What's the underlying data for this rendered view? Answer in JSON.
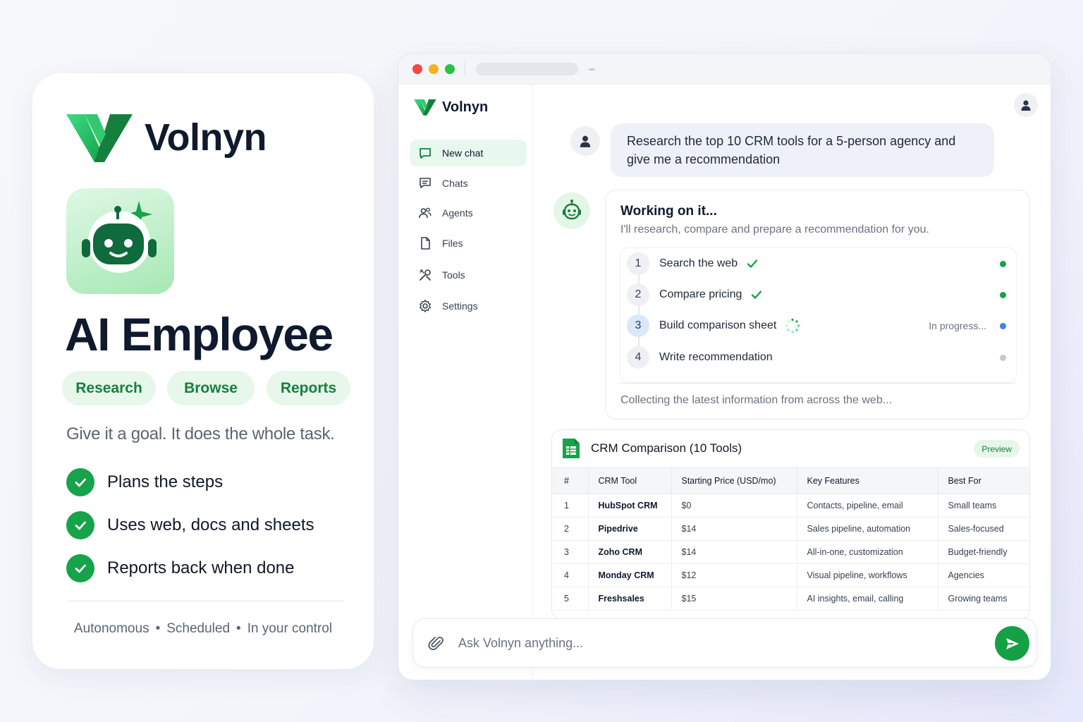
{
  "promo": {
    "brand_name": "Volnyn",
    "headline": "AI Employee",
    "pills": [
      "Research",
      "Browse",
      "Reports"
    ],
    "tagline": "Give it a goal. It does the whole task.",
    "features": [
      "Plans the steps",
      "Uses web, docs and sheets",
      "Reports back when done"
    ],
    "footer": [
      "Autonomous",
      "Scheduled",
      "In your control"
    ],
    "icons": {
      "logo": "v-logo-icon",
      "bot": "robot-sparkle-icon",
      "check": "check-circle-icon"
    }
  },
  "app": {
    "brand_name": "Volnyn",
    "sidebar": {
      "items": [
        {
          "label": "New chat",
          "icon": "chat-bubble-icon",
          "active": true
        },
        {
          "label": "Chats",
          "icon": "chats-icon",
          "active": false
        },
        {
          "label": "Agents",
          "icon": "agents-icon",
          "active": false
        },
        {
          "label": "Files",
          "icon": "file-icon",
          "active": false
        },
        {
          "label": "Tools",
          "icon": "tools-icon",
          "active": false
        },
        {
          "label": "Settings",
          "icon": "gear-icon",
          "active": false
        }
      ]
    },
    "user_message": "Research the top 10 CRM tools for a 5-person agency and give me a recommendation",
    "working": {
      "title": "Working on it...",
      "subtitle": "I'll research, compare and prepare a recommendation for you.",
      "steps": [
        {
          "num": "1",
          "label": "Search the web",
          "state": "done",
          "status": ""
        },
        {
          "num": "2",
          "label": "Compare pricing",
          "state": "done",
          "status": ""
        },
        {
          "num": "3",
          "label": "Build comparison sheet",
          "state": "in-progress",
          "status": "In progress..."
        },
        {
          "num": "4",
          "label": "Write recommendation",
          "state": "pending",
          "status": ""
        }
      ],
      "footer": "Collecting the latest information from across the web..."
    },
    "table": {
      "title": "CRM Comparison (10 Tools)",
      "badge": "Preview",
      "columns": [
        "#",
        "CRM Tool",
        "Starting Price (USD/mo)",
        "Key Features",
        "Best For"
      ],
      "rows": [
        [
          "1",
          "HubSpot CRM",
          "$0",
          "Contacts, pipeline, email",
          "Small teams"
        ],
        [
          "2",
          "Pipedrive",
          "$14",
          "Sales pipeline, automation",
          "Sales-focused"
        ],
        [
          "3",
          "Zoho CRM",
          "$14",
          "All-in-one, customization",
          "Budget-friendly"
        ],
        [
          "4",
          "Monday CRM",
          "$12",
          "Visual pipeline, workflows",
          "Agencies"
        ],
        [
          "5",
          "Freshsales",
          "$15",
          "AI insights, email, calling",
          "Growing teams"
        ]
      ]
    },
    "composer": {
      "placeholder": "Ask Volnyn anything...",
      "value": ""
    },
    "colors": {
      "brand_green": "#16a34a",
      "dot_done": "#16a34a",
      "dot_progress": "#3b82f6",
      "dot_pending": "#c4c8d0"
    }
  }
}
